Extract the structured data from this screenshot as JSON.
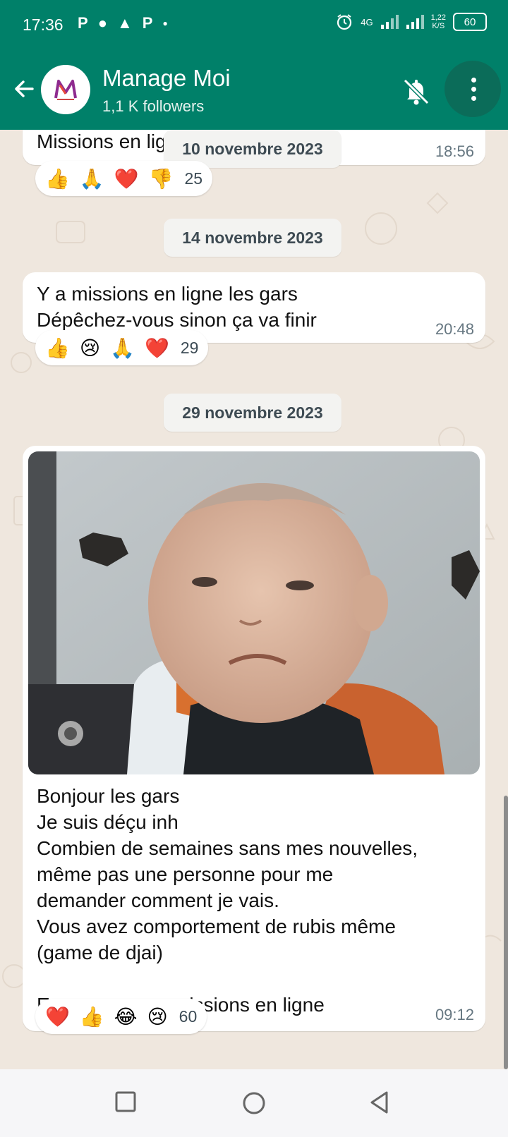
{
  "status_bar": {
    "time": "17:36",
    "network": "4G",
    "speed_value": "1,22",
    "speed_unit": "K/S",
    "battery": "60"
  },
  "header": {
    "channel_name": "Manage Moi",
    "followers": "1,1 K followers",
    "accent_color": "#008069"
  },
  "messages": [
    {
      "text": "Missions en ligne",
      "time": "18:56",
      "reactions": [
        "👍",
        "🙏",
        "❤️",
        "👎"
      ],
      "reaction_count": "25"
    },
    {
      "date": "14 novembre 2023",
      "text_lines": [
        "Y a missions en ligne les gars",
        "Dépêchez-vous sinon ça va finir"
      ],
      "time": "20:48",
      "reactions": [
        "👍",
        "😢",
        "🙏",
        "❤️"
      ],
      "reaction_count": "29"
    },
    {
      "date": "29 novembre 2023",
      "text_lines": [
        "Bonjour les gars",
        "Je suis déçu inh",
        "Combien de semaines sans mes nouvelles,",
        "même pas une personne pour me",
        "demander comment je vais.",
        "Vous avez comportement de rubis même",
        "(game de djai)",
        "",
        "En tout cas y a missions en ligne"
      ],
      "time": "09:12",
      "reactions": [
        "❤️",
        "👍",
        "😂",
        "😢"
      ],
      "reaction_count": "60"
    }
  ],
  "floating_date": "10 novembre 2023",
  "icons": {
    "back": "arrow-left-icon",
    "mute": "bell-off-icon",
    "menu": "more-vertical-icon",
    "nav": [
      "square-recents-icon",
      "circle-home-icon",
      "triangle-back-icon"
    ]
  }
}
